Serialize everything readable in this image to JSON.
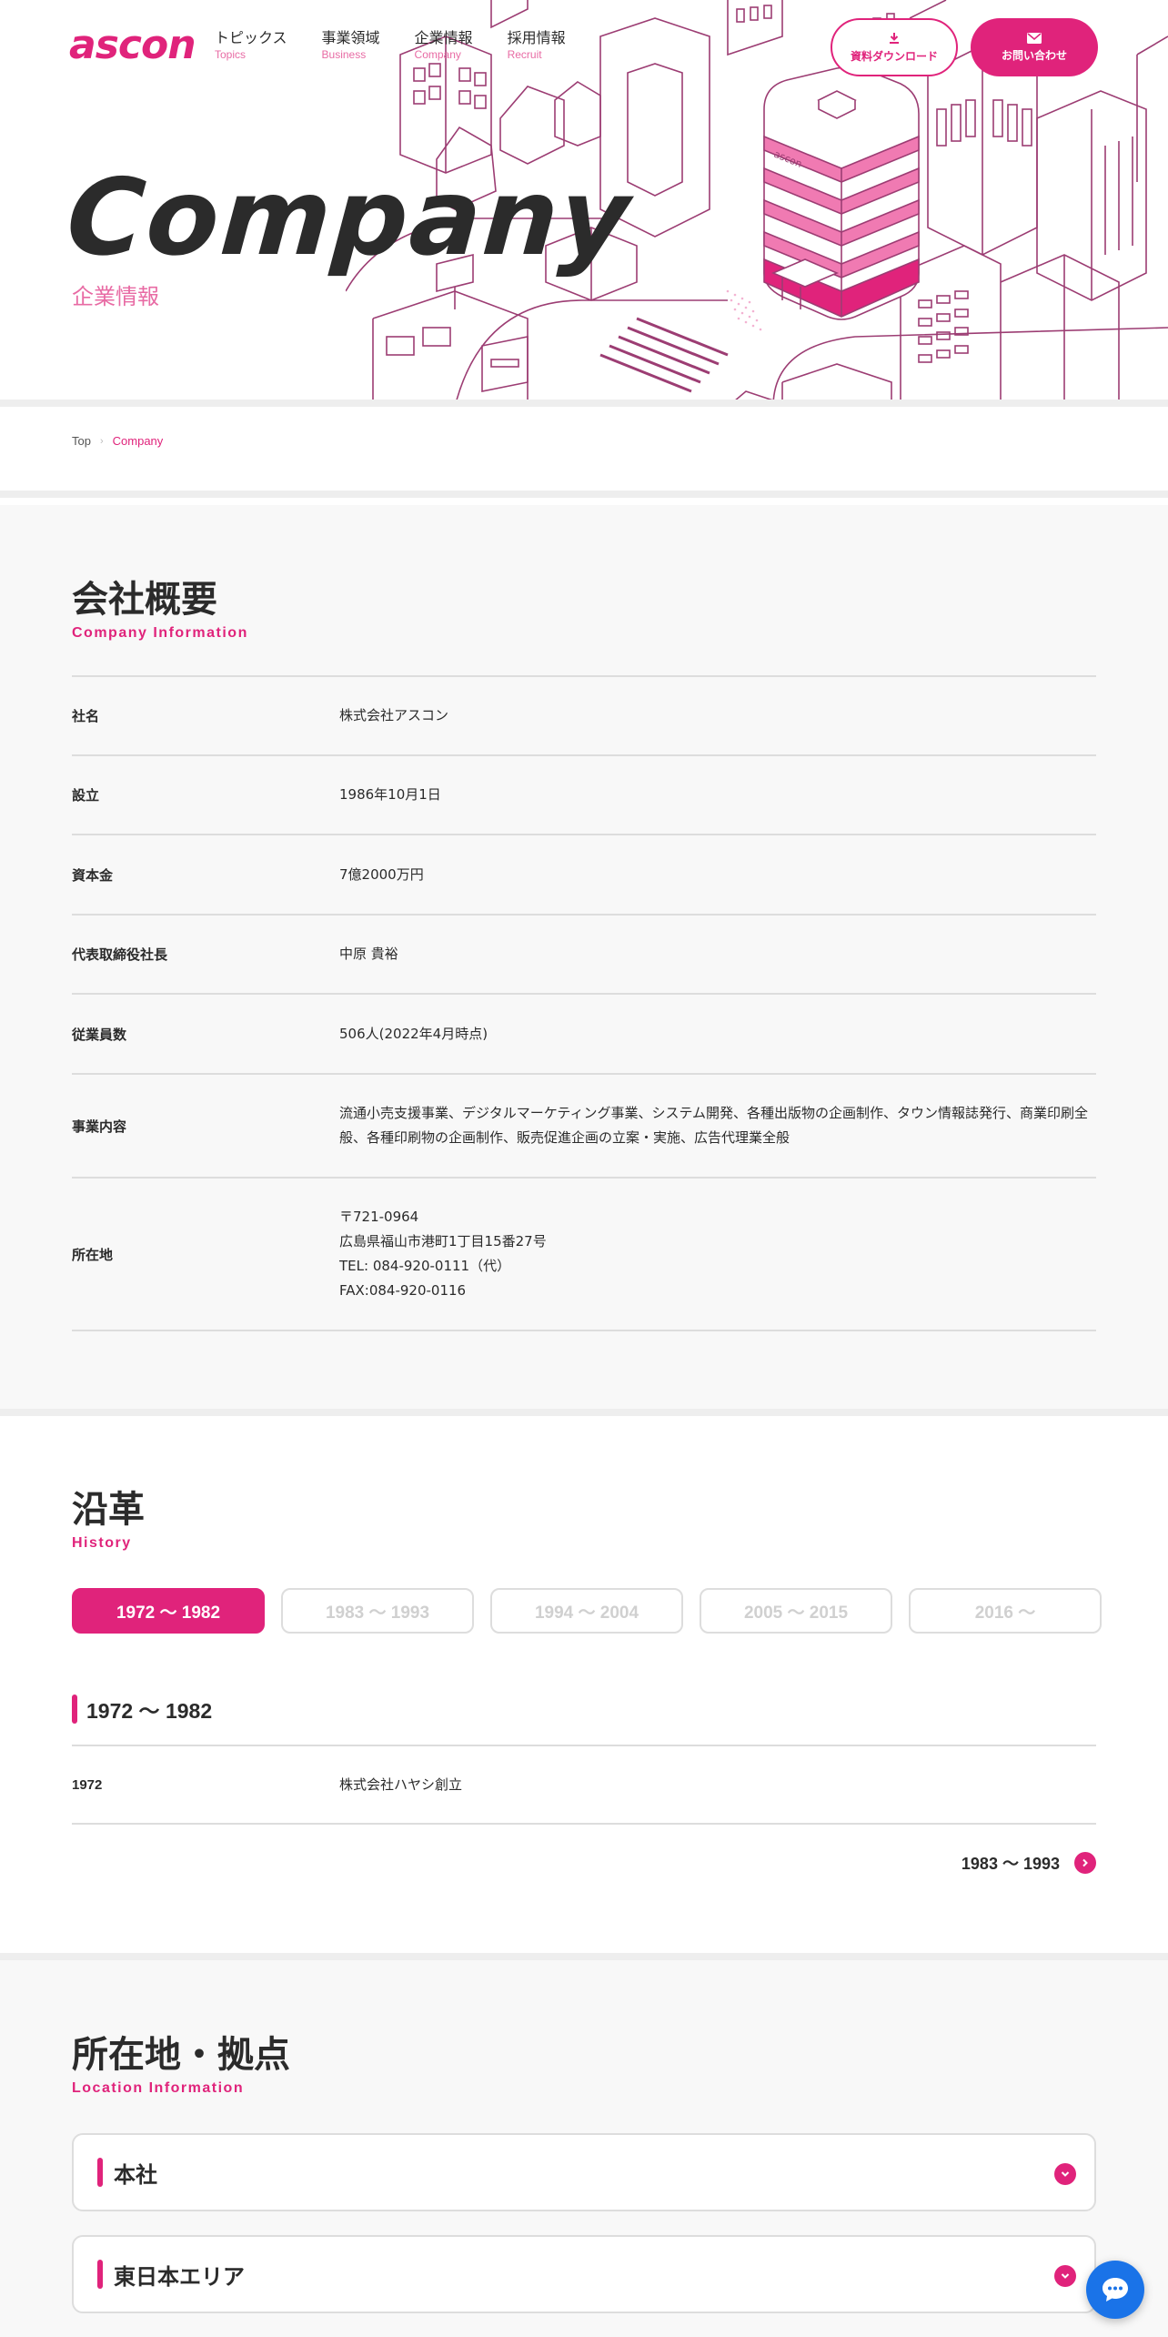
{
  "header": {
    "logo": "ascon",
    "nav": [
      {
        "ja": "トピックス",
        "en": "Topics"
      },
      {
        "ja": "事業領域",
        "en": "Business"
      },
      {
        "ja": "企業情報",
        "en": "Company"
      },
      {
        "ja": "採用情報",
        "en": "Recruit"
      }
    ],
    "download_label": "資料ダウンロード",
    "contact_label": "お問い合わせ"
  },
  "hero": {
    "title": "Company",
    "subtitle": "企業情報",
    "building_sign": "ascon"
  },
  "breadcrumb": {
    "top": "Top",
    "separator": "›",
    "current": "Company"
  },
  "company_info": {
    "title": "会社概要",
    "subtitle": "Company Information",
    "rows": [
      {
        "label": "社名",
        "value": "株式会社アスコン"
      },
      {
        "label": "設立",
        "value": "1986年10月1日"
      },
      {
        "label": "資本金",
        "value": "7億2000万円"
      },
      {
        "label": "代表取締役社長",
        "value": "中原 貴裕"
      },
      {
        "label": "従業員数",
        "value": "506人(2022年4月時点)"
      },
      {
        "label": "事業内容",
        "value": "流通小売支援事業、デジタルマーケティング事業、システム開発、各種出版物の企画制作、タウン情報誌発行、商業印刷全般、各種印刷物の企画制作、販売促進企画の立案・実施、広告代理業全般"
      },
      {
        "label": "所在地",
        "lines": [
          "〒721-0964",
          "広島県福山市港町1丁目15番27号",
          "TEL: 084-920-0111（代）",
          "FAX:084-920-0116"
        ]
      }
    ]
  },
  "history": {
    "title": "沿革",
    "subtitle": "History",
    "tabs": [
      "1972 〜 1982",
      "1983 〜 1993",
      "1994 〜 2004",
      "2005 〜 2015",
      "2016 〜"
    ],
    "active_tab": 0,
    "period_heading": "1972 〜 1982",
    "entries": [
      {
        "year": "1972",
        "event": "株式会社ハヤシ創立"
      }
    ],
    "next_label": "1983 〜 1993"
  },
  "locations": {
    "title": "所在地・拠点",
    "subtitle": "Location Information",
    "items": [
      "本社",
      "東日本エリア"
    ]
  },
  "colors": {
    "accent": "#e0237b",
    "accent_light": "#e86ba4",
    "text": "#2b2b2b",
    "gray_bg": "#f8f8f8",
    "chat": "#1a73e8"
  }
}
